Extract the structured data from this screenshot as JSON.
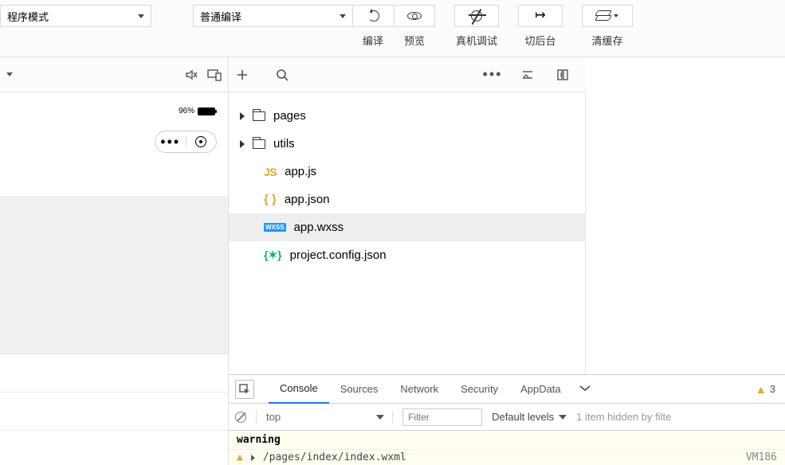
{
  "topbar": {
    "mode_select": "程序模式",
    "compile_select": "普通编译",
    "btn_compile": "编译",
    "btn_preview": "预览",
    "btn_remote_debug": "真机调试",
    "btn_background": "切后台",
    "btn_clear_cache": "清缓存"
  },
  "phone": {
    "battery_pct": "96%"
  },
  "tree": {
    "folders": [
      {
        "name": "pages"
      },
      {
        "name": "utils"
      }
    ],
    "files": [
      {
        "badge": "JS",
        "name": "app.js"
      },
      {
        "badge": "{ }",
        "name": "app.json"
      },
      {
        "badge": "WXSS",
        "name": "app.wxss",
        "selected": true
      },
      {
        "badge": "{✶}",
        "name": "project.config.json"
      }
    ]
  },
  "devtools": {
    "tabs": [
      "Console",
      "Sources",
      "Network",
      "Security",
      "AppData"
    ],
    "active_tab": "Console",
    "warn_count": "3",
    "context": "top",
    "filter_placeholder": "Filter",
    "levels": "Default levels",
    "hidden_note": "1 item hidden by filte",
    "msg_label": "warning",
    "sub_path": "/pages/index/index.wxml",
    "sub_src": "VM186"
  }
}
